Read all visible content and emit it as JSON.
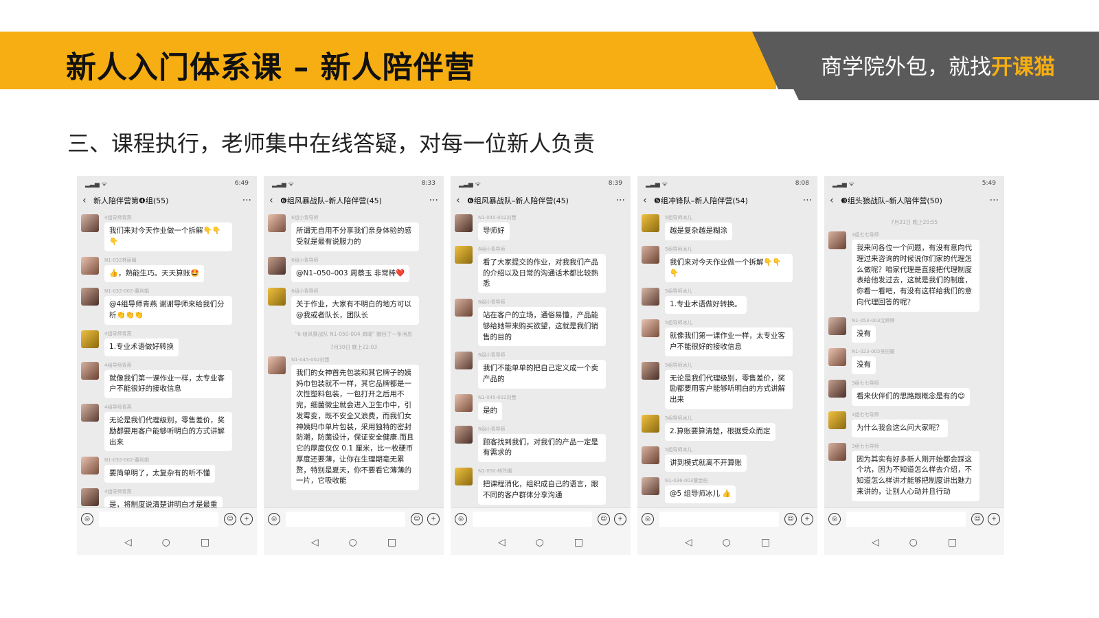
{
  "header": {
    "title": "新人入门体系课 – 新人陪伴营",
    "tagline_prefix": "商学院外包，就找",
    "tagline_highlight": "开课猫"
  },
  "subtitle": "三、课程执行，老师集中在线答疑，对每一位新人负责",
  "phones": [
    {
      "time": "6:49",
      "chat_title": "新人陪伴营第❹组(55)",
      "messages": [
        {
          "sender": "4组导师青燕",
          "text": "我们来对今天作业做一个拆解👇👇👇"
        },
        {
          "sender": "N1-032林丽媚",
          "text": "👍，熟能生巧。天天算账🤩"
        },
        {
          "sender": "N1-032-002-董利娟",
          "text": "@4组导师青燕 谢谢导师来给我们分析👏👏👏"
        },
        {
          "sender": "4组导师青燕",
          "text": "1.专业术语做好转换"
        },
        {
          "sender": "4组导师青燕",
          "text": "就像我们第一课作业一样，太专业客户不能很好的接收信息"
        },
        {
          "sender": "4组导师青燕",
          "text": "无论是我们代理级别，零售差价，奖励都要用客户能够听明白的方式讲解出来"
        },
        {
          "sender": "N1-032-002-董利娟",
          "text": "要简单明了，太复杂有的听不懂"
        },
        {
          "sender": "4组导师青燕",
          "text": "是，将制度说清楚讲明白才是最重"
        }
      ]
    },
    {
      "time": "8:33",
      "chat_title": "❻组风暴战队–新人陪伴营(45)",
      "messages": [
        {
          "sender": "6组小青导师",
          "text": "所谓无自用不分享我们亲身体验的感受就是最有说服力的"
        },
        {
          "sender": "6组小青导师",
          "text": "@N1–050–003 周蔡玉 非常棒❤️"
        },
        {
          "sender": "6组小青导师",
          "text": "关于作业，大家有不明白的地方可以@我或者队长，团队长"
        }
      ],
      "system_note": "\"6 组风暴战队 N1-050-004 周璐\" 撤回了一条消息",
      "date_note": "7月30日 晚上22:03",
      "messages_after": [
        {
          "sender": "N1-045-002刘慧",
          "text": "我们的女神首先包装和其它牌子的姨妈巾包装就不一样，其它品牌都是一次性塑料包装，一包打开之后用不完，细菌微尘就会进入卫生巾中，引发霉变，既不安全又浪费，而我们女神姨妈巾单片包装，采用独特的密封防潮，防菌设计，保证安全健康.而且它的厚度仅仅 0.1 厘米，比一枚硬币厚度还要薄，让你在生理期毫无累赘，特别是夏天，你不要看它薄薄的一片，它吸收能"
        }
      ]
    },
    {
      "time": "8:39",
      "chat_title": "❻组风暴战队–新人陪伴营(45)",
      "messages": [
        {
          "sender": "N1-045-002刘慧",
          "text": "导师好"
        },
        {
          "sender": "6组小青导师",
          "text": "看了大家提交的作业，对我我们产品的介绍以及日常的沟通话术都比较熟悉"
        },
        {
          "sender": "6组小青导师",
          "text": "站在客户的立场，通俗易懂，产品能够给她带来购买欲望，这就是我们销售的目的"
        },
        {
          "sender": "6组小青导师",
          "text": "我们不能单单的把自己定义成一个卖产品的"
        },
        {
          "sender": "N1-045-002刘慧",
          "text": "是的"
        },
        {
          "sender": "6组小青导师",
          "text": "顾客找到我们，对我们的产品一定是有需求的"
        },
        {
          "sender": "N1-050-林玲媚",
          "text": "把课程消化，组织成自己的语言，跟不同的客户群体分享沟通"
        }
      ]
    },
    {
      "time": "8:08",
      "chat_title": "❺组冲锋队–新人陪伴营(54)",
      "messages": [
        {
          "sender": "5组导师冰儿",
          "text": "越是复杂越是糊涂"
        },
        {
          "sender": "5组导师冰儿",
          "text": "我们来对今天作业做一个拆解👇👇👇"
        },
        {
          "sender": "5组导师冰儿",
          "text": "1.专业术语做好转换。"
        },
        {
          "sender": "5组导师冰儿",
          "text": "就像我们第一课作业一样，太专业客户不能很好的接收信息"
        },
        {
          "sender": "5组导师冰儿",
          "text": "无论是我们代理级别，零售差价，奖励都要用客户能够听明白的方式讲解出来"
        },
        {
          "sender": "5组导师冰儿",
          "text": "2.算账要算清楚，根据受众而定"
        },
        {
          "sender": "5组导师冰儿",
          "text": "讲到模式就离不开算账"
        },
        {
          "sender": "N1-036-003董金柏",
          "text": "@5 组导师冰儿 👍"
        }
      ]
    },
    {
      "time": "5:49",
      "chat_title": "❸组头狼战队–新人陪伴营(50)",
      "date_note": "7月31日 晚上20:55",
      "messages": [
        {
          "sender": "3组七七导师",
          "text": "我来问各位一个问题，有没有意向代理过来咨询的时候说你们家的代理怎么做呢？咱家代理是直接把代理制度表给他发过去，这就是我们的制度，你看一看吧，有没有这样给我们的意向代理回答的呢？"
        },
        {
          "sender": "N1-053-003沈婷婷",
          "text": "没有"
        },
        {
          "sender": "N1-023-005吴田媛",
          "text": "没有"
        },
        {
          "sender": "3组七七导师",
          "text": "看来伙伴们的思路跟概念是有的😊"
        },
        {
          "sender": "3组七七导师",
          "text": "为什么我会这么问大家呢？"
        },
        {
          "sender": "3组七七导师",
          "text": "因为其实有好多新人刚开始都会踩这个坑，因为不知道怎么样去介绍，不知道怎么样讲才能够把制度讲出魅力来讲的，让别人心动并且行动"
        }
      ]
    }
  ],
  "icons": {
    "back": "‹",
    "more": "···",
    "voice": "◎",
    "emoji": "☺",
    "plus": "+",
    "nav_back": "◁",
    "nav_home": "○",
    "nav_recent": "□"
  }
}
